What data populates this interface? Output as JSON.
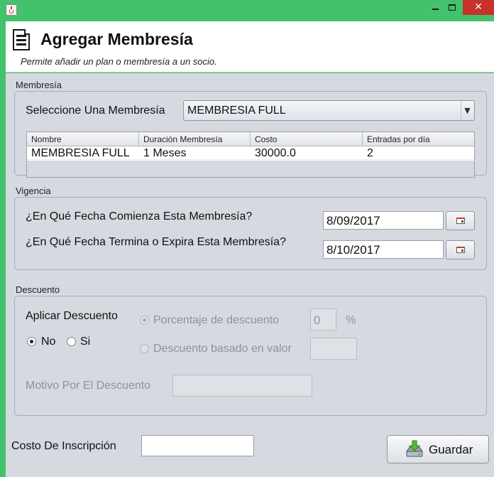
{
  "window": {
    "minimize_glyph": "",
    "maximize_glyph": "",
    "close_glyph": "✕",
    "accent": "#42c26a",
    "close_color": "#c7302b"
  },
  "header": {
    "icon": "document-icon",
    "title": "Agregar Membresía",
    "subtitle": "Permite añadir un plan o membresía a un socio."
  },
  "membership": {
    "section_label": "Membresía",
    "select_label": "Seleccione Una Membresía",
    "selected": "MEMBRESIA FULL",
    "arrow": "▼",
    "table": {
      "columns": [
        "Nombre",
        "Duración Membresía",
        "Costo",
        "Entradas por día"
      ],
      "rows": [
        [
          "MEMBRESIA FULL",
          "1  Meses",
          "30000.0",
          "2"
        ]
      ]
    }
  },
  "vigencia": {
    "section_label": "Vigencia",
    "start_label": "¿En Qué Fecha Comienza Esta Membresía?",
    "start_value": "8/09/2017",
    "end_label": "¿En Qué Fecha Termina o Expira Esta Membresía?",
    "end_value": "8/10/2017"
  },
  "descuento": {
    "section_label": "Descuento",
    "apply_label": "Aplicar Descuento",
    "option_no": "No",
    "option_si": "Si",
    "selected_option": "No",
    "percent_label": "Porcentaje de descuento",
    "percent_value": "0",
    "percent_unit": "%",
    "value_label": "Descuento basado en valor",
    "value_value": "",
    "reason_label": "Motivo Por El Descuento",
    "reason_value": ""
  },
  "footer": {
    "inscription_label": "Costo De Inscripción",
    "inscription_value": "",
    "save_label": "Guardar",
    "save_icon": "save-drive-icon"
  }
}
